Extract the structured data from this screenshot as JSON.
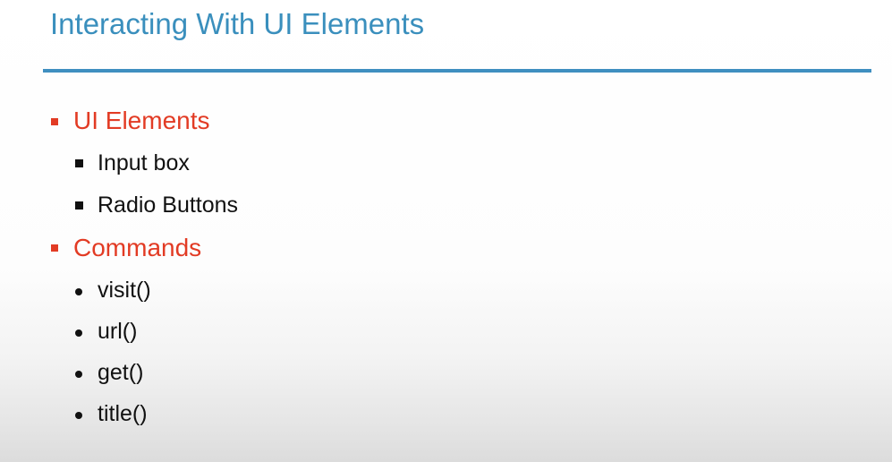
{
  "slide": {
    "title": "Interacting With UI Elements",
    "sections": [
      {
        "label": "UI Elements",
        "items": [
          "Input box",
          "Radio Buttons"
        ]
      },
      {
        "label": "Commands",
        "items": [
          "visit()",
          "url()",
          "get()",
          "title()"
        ]
      }
    ]
  },
  "colors": {
    "title": "#3a8fbd",
    "rule": "#3f8fc0",
    "section_label": "#e23b24",
    "body_text": "#111111"
  }
}
